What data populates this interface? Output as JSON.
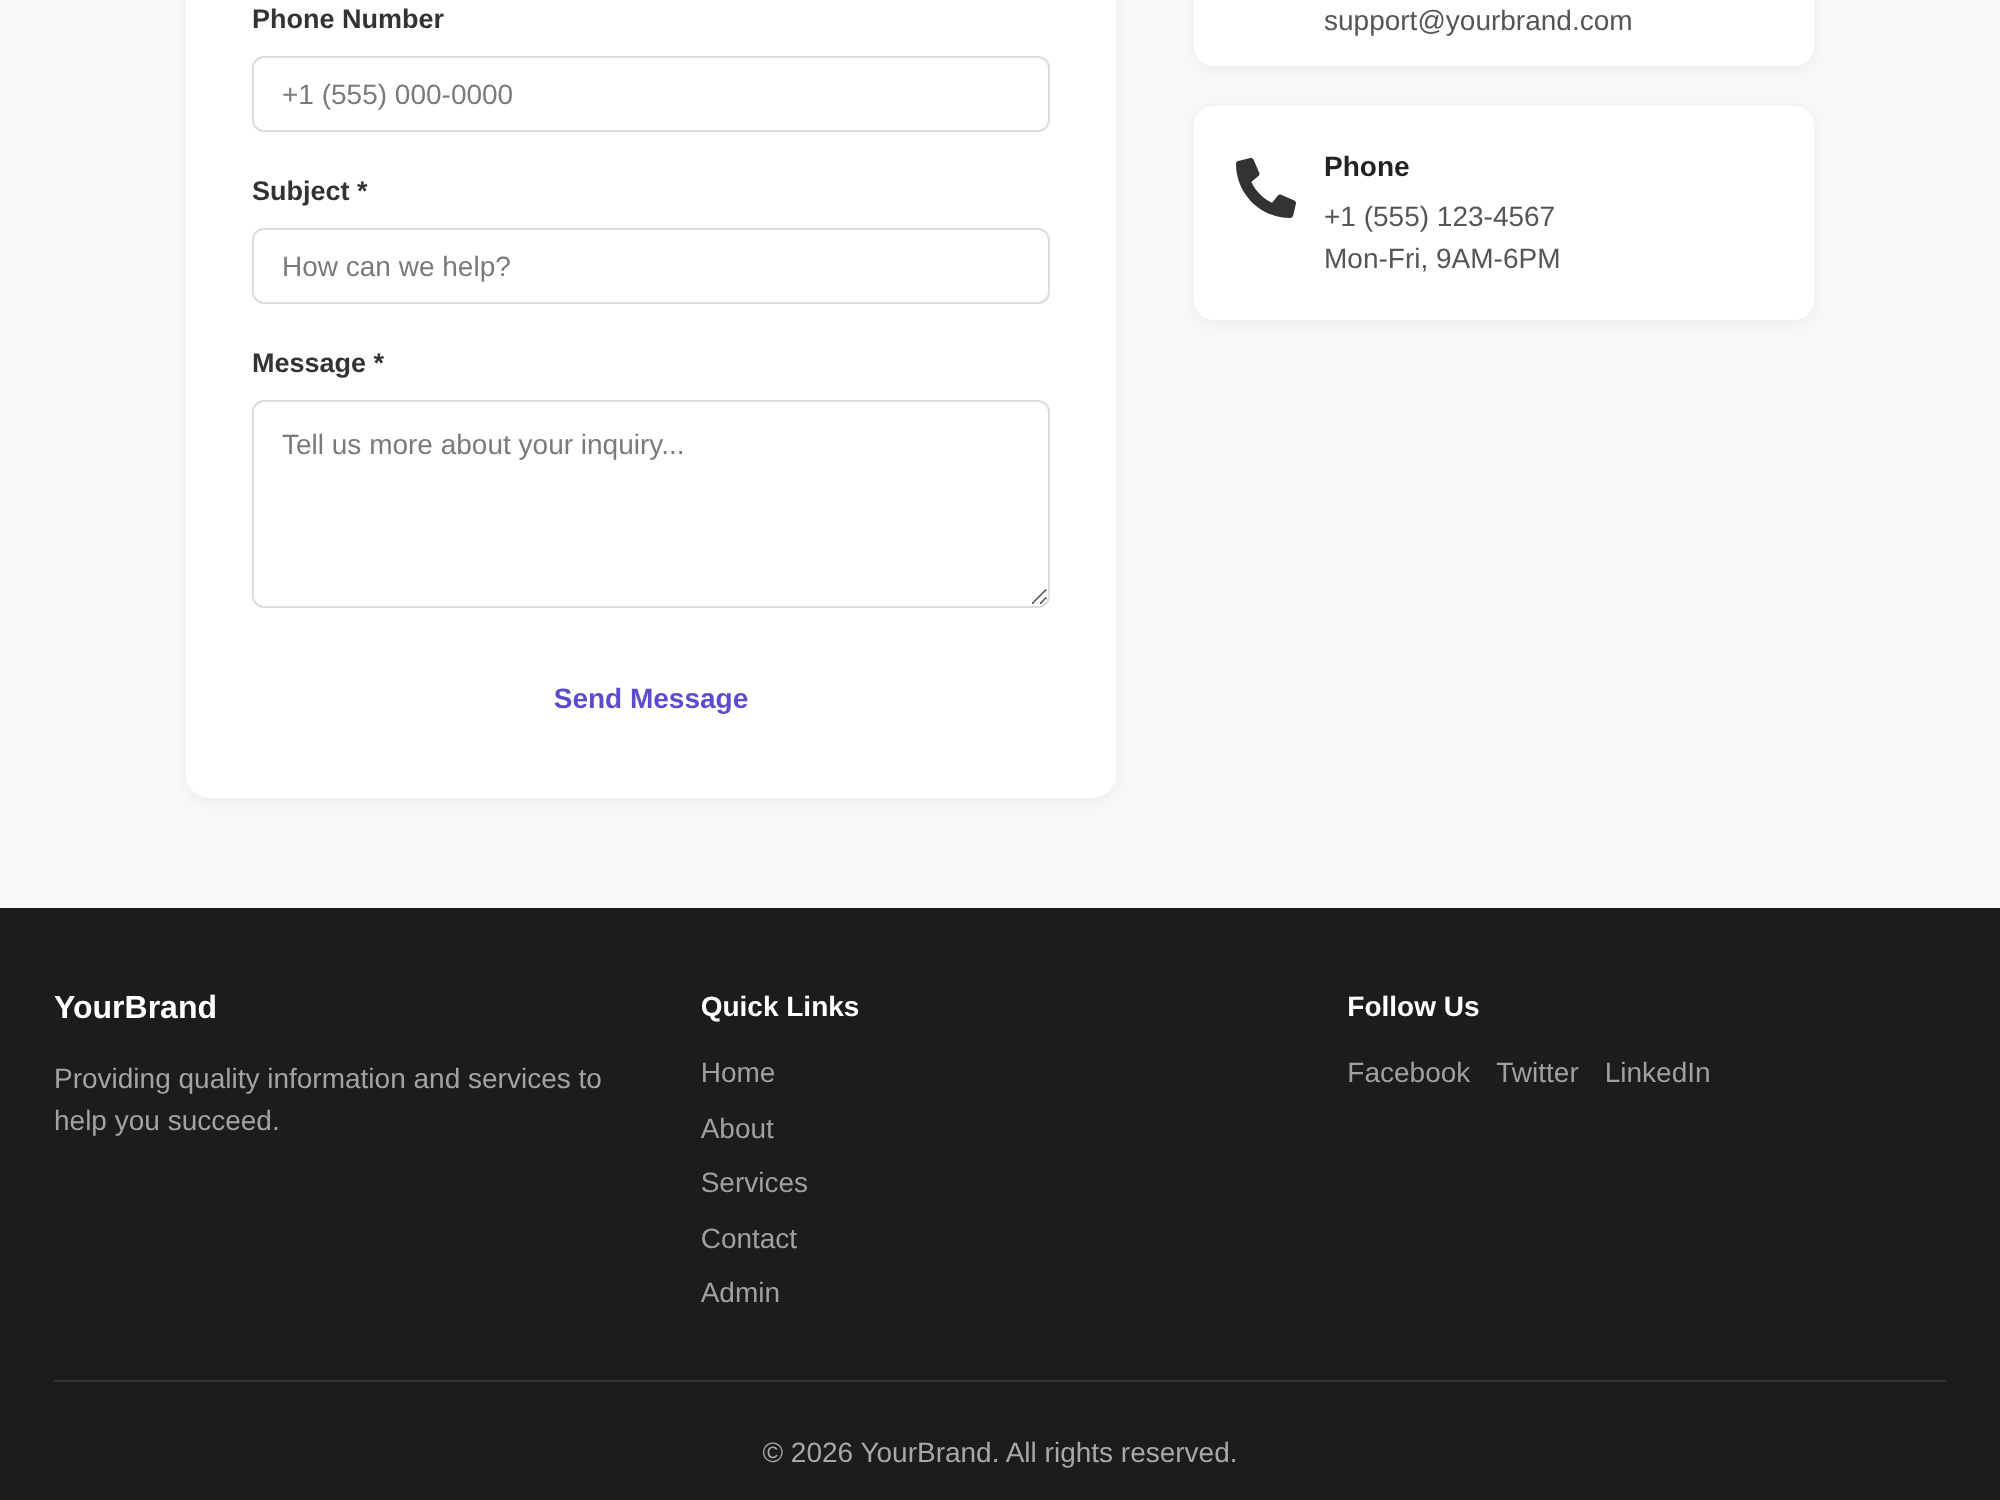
{
  "contact_form": {
    "fields": [
      {
        "kind": "input",
        "label": "Phone Number",
        "placeholder": "+1 (555) 000-0000"
      },
      {
        "kind": "input",
        "label": "Subject *",
        "placeholder": "How can we help?"
      },
      {
        "kind": "textarea",
        "label": "Message *",
        "placeholder": "Tell us more about your inquiry..."
      }
    ],
    "submit_button": "Send Message"
  },
  "contact_info": [
    {
      "lines": [
        "support@yourbrand.com"
      ]
    },
    {
      "title": "Phone",
      "lines": [
        "+1 (555) 123-4567",
        "Mon-Fri, 9AM-6PM"
      ]
    }
  ],
  "footer": {
    "brand": {
      "name": "YourBrand",
      "description": "Providing quality information and services to help you succeed."
    },
    "columns": [
      {
        "heading": "Quick Links",
        "kind": "list",
        "links": [
          "Home",
          "About",
          "Services",
          "Contact",
          "Admin"
        ]
      },
      {
        "heading": "Follow Us",
        "kind": "inline",
        "links": [
          "Facebook",
          "Twitter",
          "LinkedIn"
        ]
      }
    ],
    "copyright": "© 2026 YourBrand. All rights reserved."
  }
}
